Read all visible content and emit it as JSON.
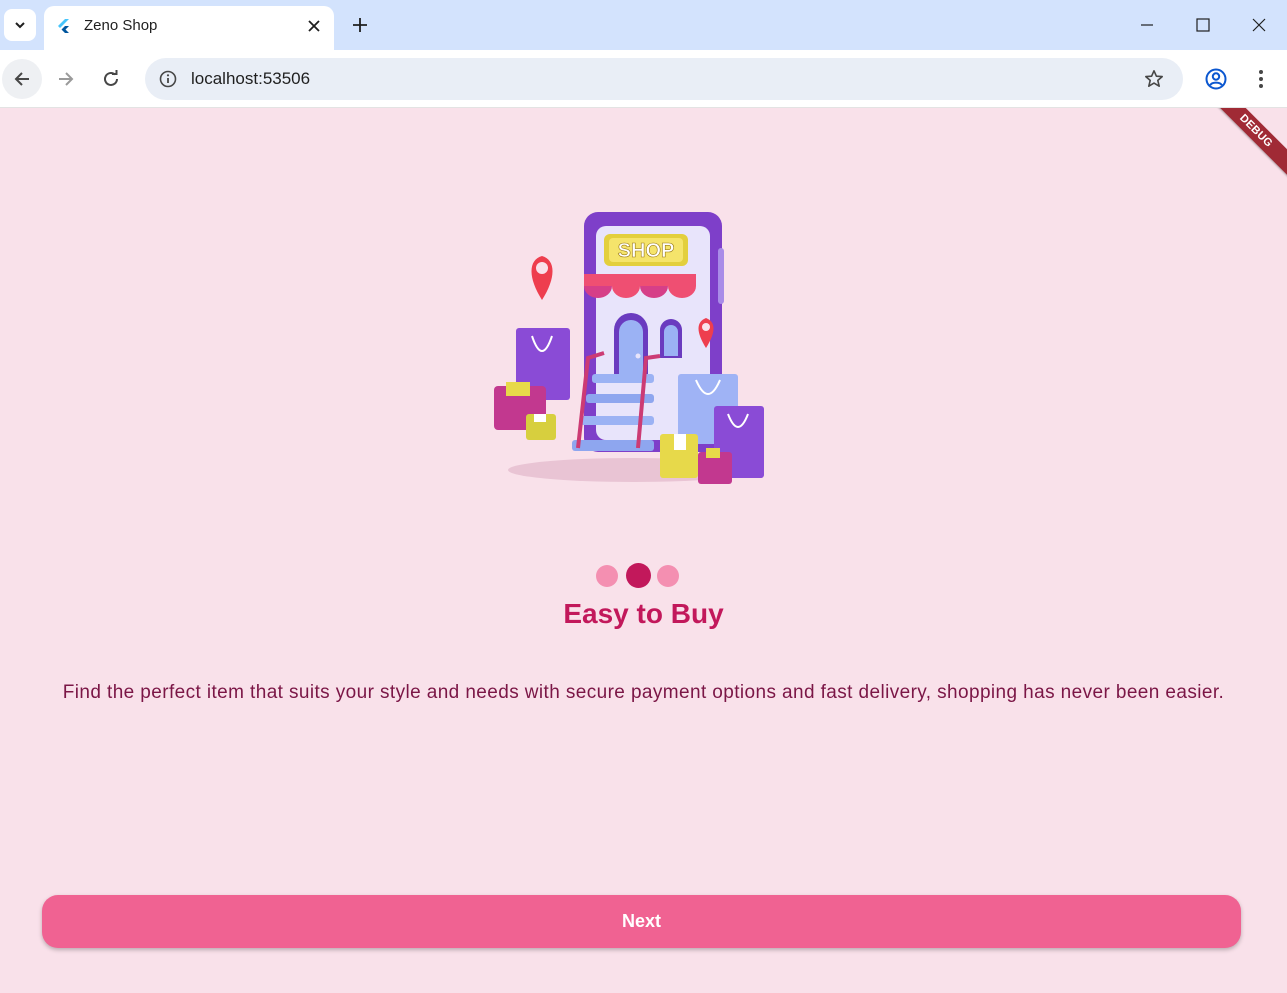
{
  "browser": {
    "tab_title": "Zeno Shop",
    "url": "localhost:53506",
    "icons": {
      "tab_search": "chevron-down-icon",
      "favicon": "flutter-icon",
      "close_tab": "close-icon",
      "new_tab": "plus-icon",
      "minimize": "minimize-icon",
      "maximize": "maximize-icon",
      "close_window": "close-icon",
      "back": "arrow-left-icon",
      "forward": "arrow-right-icon",
      "reload": "reload-icon",
      "site_info": "info-icon",
      "bookmark": "star-icon",
      "profile": "profile-icon",
      "menu": "kebab-menu-icon"
    }
  },
  "app": {
    "debug_banner": "DEBUG",
    "onboarding": {
      "illustration": "shop-storefront-illustration",
      "illustration_sign": "SHOP",
      "page_indicator": {
        "total": 3,
        "active_index": 1
      },
      "title": "Easy to Buy",
      "description": "Find the perfect item that suits your style and needs with secure payment options and fast delivery, shopping has never been easier.",
      "next_button": "Next"
    },
    "colors": {
      "background": "#f9e1ea",
      "primary": "#c2185b",
      "button": "#f06292",
      "dot_inactive": "#f48fb1",
      "dot_active": "#c2185b"
    }
  }
}
